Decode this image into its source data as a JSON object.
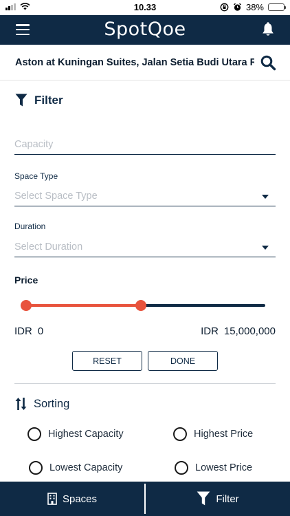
{
  "status_bar": {
    "time": "10.33",
    "battery": "38%",
    "battery_level": 0.38
  },
  "header": {
    "brand": "SpotQoe",
    "menu_icon": "hamburger-icon",
    "notification_icon": "bell-icon"
  },
  "search": {
    "location": "Aston at Kuningan Suites, Jalan Setia Budi Utara Raya...",
    "search_icon": "search-icon"
  },
  "filter": {
    "title": "Filter",
    "capacity_placeholder": "Capacity",
    "space_type_label": "Space Type",
    "space_type_placeholder": "Select Space Type",
    "duration_label": "Duration",
    "duration_placeholder": "Select Duration",
    "price_label": "Price",
    "price_min_currency": "IDR",
    "price_min_value": "0",
    "price_max_currency": "IDR",
    "price_max_value": "15,000,000",
    "slider_low_fraction": 0.0,
    "slider_high_fraction": 0.49,
    "reset_label": "RESET",
    "done_label": "DONE"
  },
  "sorting": {
    "title": "Sorting",
    "options": [
      {
        "label": "Highest Capacity",
        "selected": false
      },
      {
        "label": "Highest Price",
        "selected": false
      },
      {
        "label": "Lowest Capacity",
        "selected": false
      },
      {
        "label": "Lowest Price",
        "selected": false
      }
    ]
  },
  "tabs": [
    {
      "label": "Spaces",
      "icon": "building-icon"
    },
    {
      "label": "Filter",
      "icon": "funnel-icon"
    }
  ],
  "colors": {
    "primary": "#0f2a45",
    "accent": "#e8533d"
  }
}
